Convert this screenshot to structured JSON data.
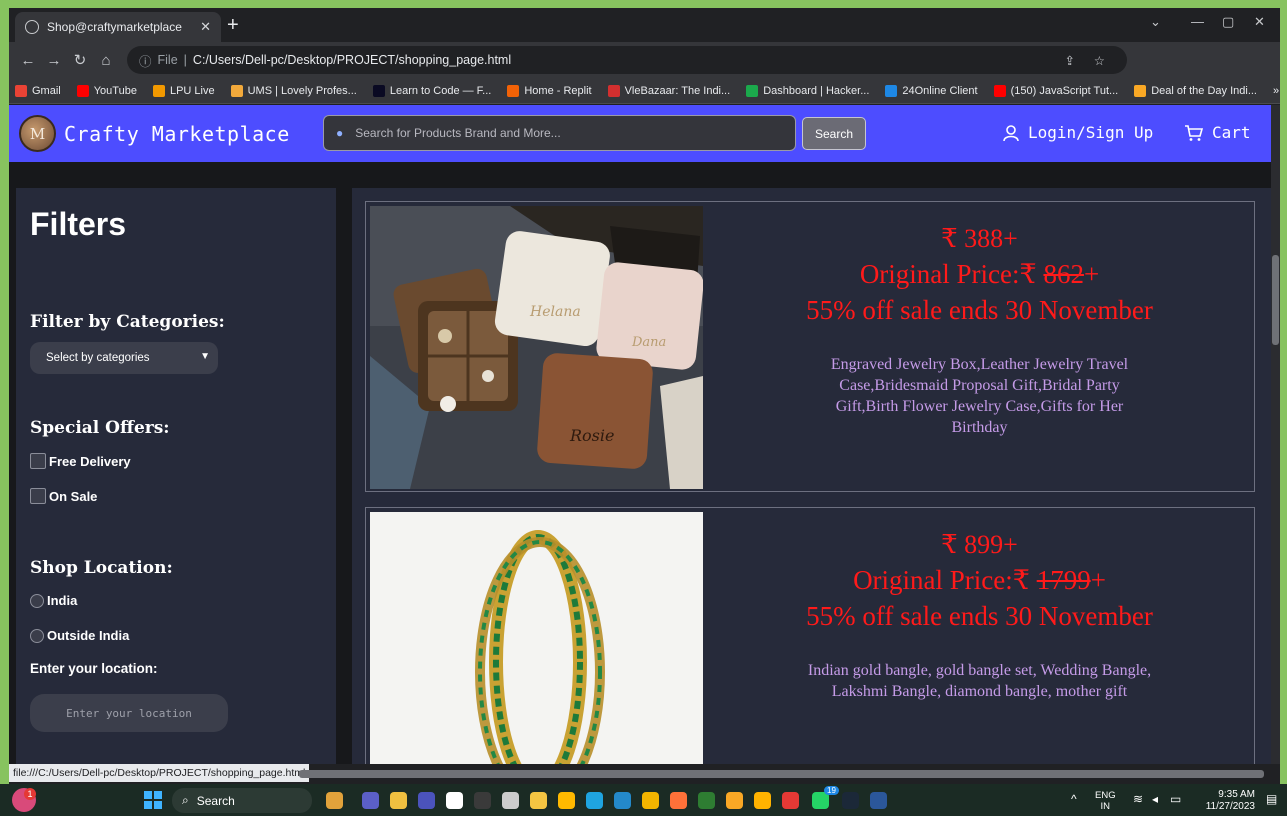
{
  "browser": {
    "tab_title": "Shop@craftymarketplace",
    "url_prefix": "File",
    "url": "C:/Users/Dell-pc/Desktop/PROJECT/shopping_page.html",
    "status_url": "file:///C:/Users/Dell-pc/Desktop/PROJECT/shopping_page.html",
    "bookmarks": [
      {
        "label": "Gmail",
        "color": "#ea4335"
      },
      {
        "label": "YouTube",
        "color": "#ff0000"
      },
      {
        "label": "LPU Live",
        "color": "#f29900"
      },
      {
        "label": "UMS | Lovely Profes...",
        "color": "#f2a93b"
      },
      {
        "label": "Learn to Code — F...",
        "color": "#0a0a23"
      },
      {
        "label": "Home - Replit",
        "color": "#f26207"
      },
      {
        "label": "VleBazaar: The Indi...",
        "color": "#d32f2f"
      },
      {
        "label": "Dashboard | Hacker...",
        "color": "#1ba94c"
      },
      {
        "label": "24Online Client",
        "color": "#1e88e5"
      },
      {
        "label": "(150) JavaScript Tut...",
        "color": "#ff0000"
      },
      {
        "label": "Deal of the Day Indi...",
        "color": "#f9a825"
      }
    ]
  },
  "header": {
    "logo_letter": "M",
    "brand": "Crafty Marketplace",
    "search_placeholder": "Search for Products Brand and More...",
    "search_button": "Search",
    "login": "Login/Sign Up",
    "cart": "Cart"
  },
  "filters": {
    "title": "Filters",
    "categories_heading": "Filter by Categories:",
    "categories_select": "Select by categories",
    "offers_heading": "Special Offers:",
    "offers": [
      "Free Delivery",
      "On Sale"
    ],
    "location_heading": "Shop Location:",
    "locations": [
      "India",
      "Outside India"
    ],
    "location_label": "Enter your location:",
    "location_placeholder": "Enter your location"
  },
  "products": [
    {
      "price": "₹ 388+",
      "original_label": "Original Price:₹ ",
      "original_value": "862",
      "original_suffix": "+",
      "sale": "55% off sale ends 30 November",
      "description": "Engraved Jewelry Box,Leather Jewelry Travel Case,Bridesmaid Proposal Gift,Bridal Party Gift,Birth Flower Jewelry Case,Gifts for Her Birthday",
      "engravings": [
        "Helana",
        "Dana",
        "Rosie"
      ]
    },
    {
      "price": "₹ 899+",
      "original_label": "Original Price:₹ ",
      "original_value": "1799",
      "original_suffix": "+",
      "sale": "55% off sale ends 30 November",
      "description": "Indian gold bangle, gold bangle set, Wedding Bangle, Lakshmi Bangle, diamond bangle, mother gift"
    }
  ],
  "taskbar": {
    "search": "Search",
    "lang": "ENG",
    "region": "IN",
    "time": "9:35 AM",
    "date": "11/27/2023",
    "notification_count": "1",
    "whatsapp_badge": "19"
  },
  "colors": {
    "nav_bg": "#4d4dff",
    "panel_bg": "#262a3a",
    "price_red": "#ff1a1a",
    "desc_purple": "#c59be8"
  }
}
